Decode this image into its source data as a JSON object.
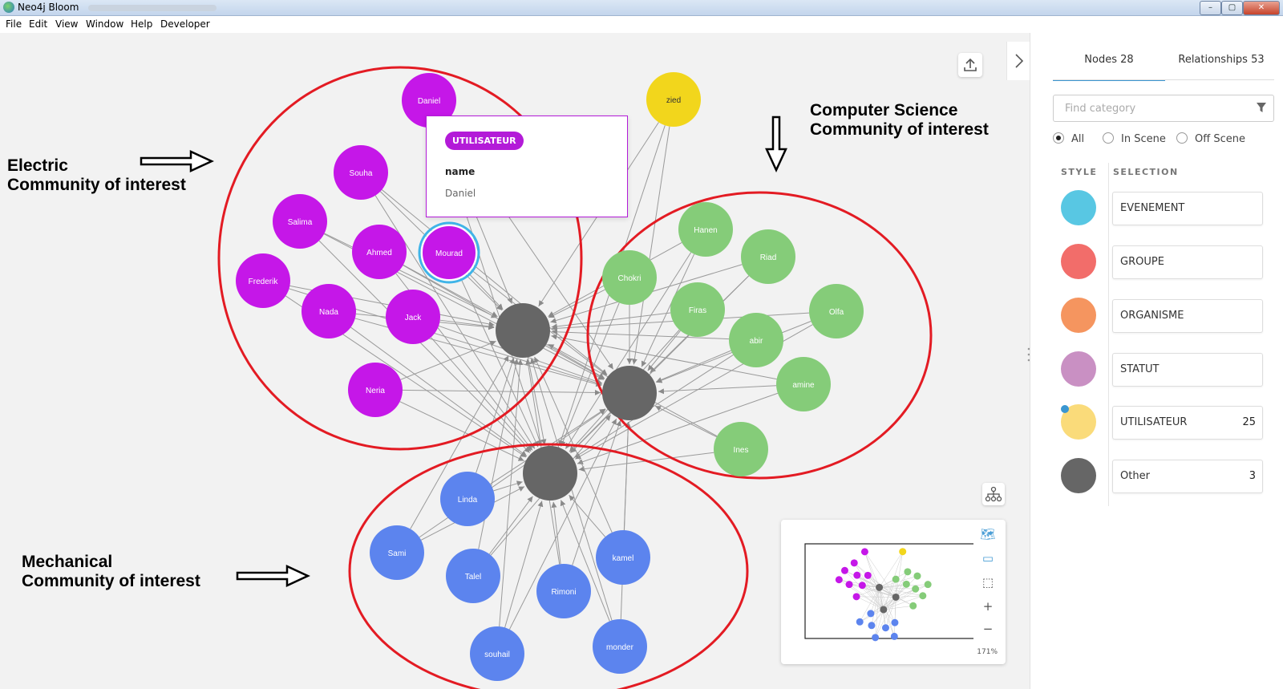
{
  "window": {
    "title": "Neo4j Bloom",
    "controls": [
      "–",
      "▢",
      "✕"
    ]
  },
  "menu": [
    "File",
    "Edit",
    "View",
    "Window",
    "Help",
    "Developer"
  ],
  "annotations": [
    {
      "line1": "Electric",
      "line2": "Community of interest"
    },
    {
      "line1": "Computer Science",
      "line2": "Community of interest"
    },
    {
      "line1": "Mechanical",
      "line2": "Community of interest"
    }
  ],
  "tooltip": {
    "label": "UTILISATEUR",
    "key": "name",
    "value": "Daniel"
  },
  "graph": {
    "colors": {
      "purple": "#c517e8",
      "green": "#85cc79",
      "blue": "#5c84ee",
      "yellow": "#f2d61c",
      "gray": "#666666",
      "ring": "#e31b23",
      "selected": "#3fb4e8"
    },
    "nodes": [
      {
        "id": "hub1",
        "label": "",
        "group": "gray"
      },
      {
        "id": "hub2",
        "label": "",
        "group": "gray"
      },
      {
        "id": "hub3",
        "label": "",
        "group": "gray"
      },
      {
        "id": "daniel",
        "label": "Daniel",
        "group": "purple"
      },
      {
        "id": "souha",
        "label": "Souha",
        "group": "purple"
      },
      {
        "id": "salima",
        "label": "Salima",
        "group": "purple"
      },
      {
        "id": "ahmed",
        "label": "Ahmed",
        "group": "purple"
      },
      {
        "id": "mourad",
        "label": "Mourad",
        "group": "purple",
        "selected": true
      },
      {
        "id": "frederik",
        "label": "Frederik",
        "group": "purple"
      },
      {
        "id": "nada",
        "label": "Nada",
        "group": "purple"
      },
      {
        "id": "jack",
        "label": "Jack",
        "group": "purple"
      },
      {
        "id": "neria",
        "label": "Neria",
        "group": "purple"
      },
      {
        "id": "zied",
        "label": "zied",
        "group": "yellow"
      },
      {
        "id": "hanen",
        "label": "Hanen",
        "group": "green"
      },
      {
        "id": "riad",
        "label": "Riad",
        "group": "green"
      },
      {
        "id": "chokri",
        "label": "Chokri",
        "group": "green"
      },
      {
        "id": "firas",
        "label": "Firas",
        "group": "green"
      },
      {
        "id": "olfa",
        "label": "Olfa",
        "group": "green"
      },
      {
        "id": "abir",
        "label": "abir",
        "group": "green"
      },
      {
        "id": "amine",
        "label": "amine",
        "group": "green"
      },
      {
        "id": "ines",
        "label": "Ines",
        "group": "green"
      },
      {
        "id": "linda",
        "label": "Linda",
        "group": "blue"
      },
      {
        "id": "sami",
        "label": "Sami",
        "group": "blue"
      },
      {
        "id": "talel",
        "label": "Talel",
        "group": "blue"
      },
      {
        "id": "kamel",
        "label": "kamel",
        "group": "blue"
      },
      {
        "id": "rimoni",
        "label": "Rimoni",
        "group": "blue"
      },
      {
        "id": "souhail",
        "label": "souhail",
        "group": "blue"
      },
      {
        "id": "monder",
        "label": "monder",
        "group": "blue"
      }
    ]
  },
  "minimap": {
    "zoom": "171%"
  },
  "panel": {
    "tabs": [
      {
        "label": "Nodes 28"
      },
      {
        "label": "Relationships 53"
      }
    ],
    "find_placeholder": "Find category",
    "filters": [
      "All",
      "In Scene",
      "Off Scene"
    ],
    "style_header": "STYLE",
    "selection_header": "SELECTION",
    "categories": [
      {
        "label": "EVENEMENT",
        "count": "",
        "color": "#58c7e3"
      },
      {
        "label": "GROUPE",
        "count": "",
        "color": "#f26d6a"
      },
      {
        "label": "ORGANISME",
        "count": "",
        "color": "#f5955f"
      },
      {
        "label": "STATUT",
        "count": "",
        "color": "#c990c3"
      },
      {
        "label": "UTILISATEUR",
        "count": "25",
        "color": "#fadb7a"
      },
      {
        "label": "Other",
        "count": "3",
        "color": "#666666"
      }
    ]
  }
}
